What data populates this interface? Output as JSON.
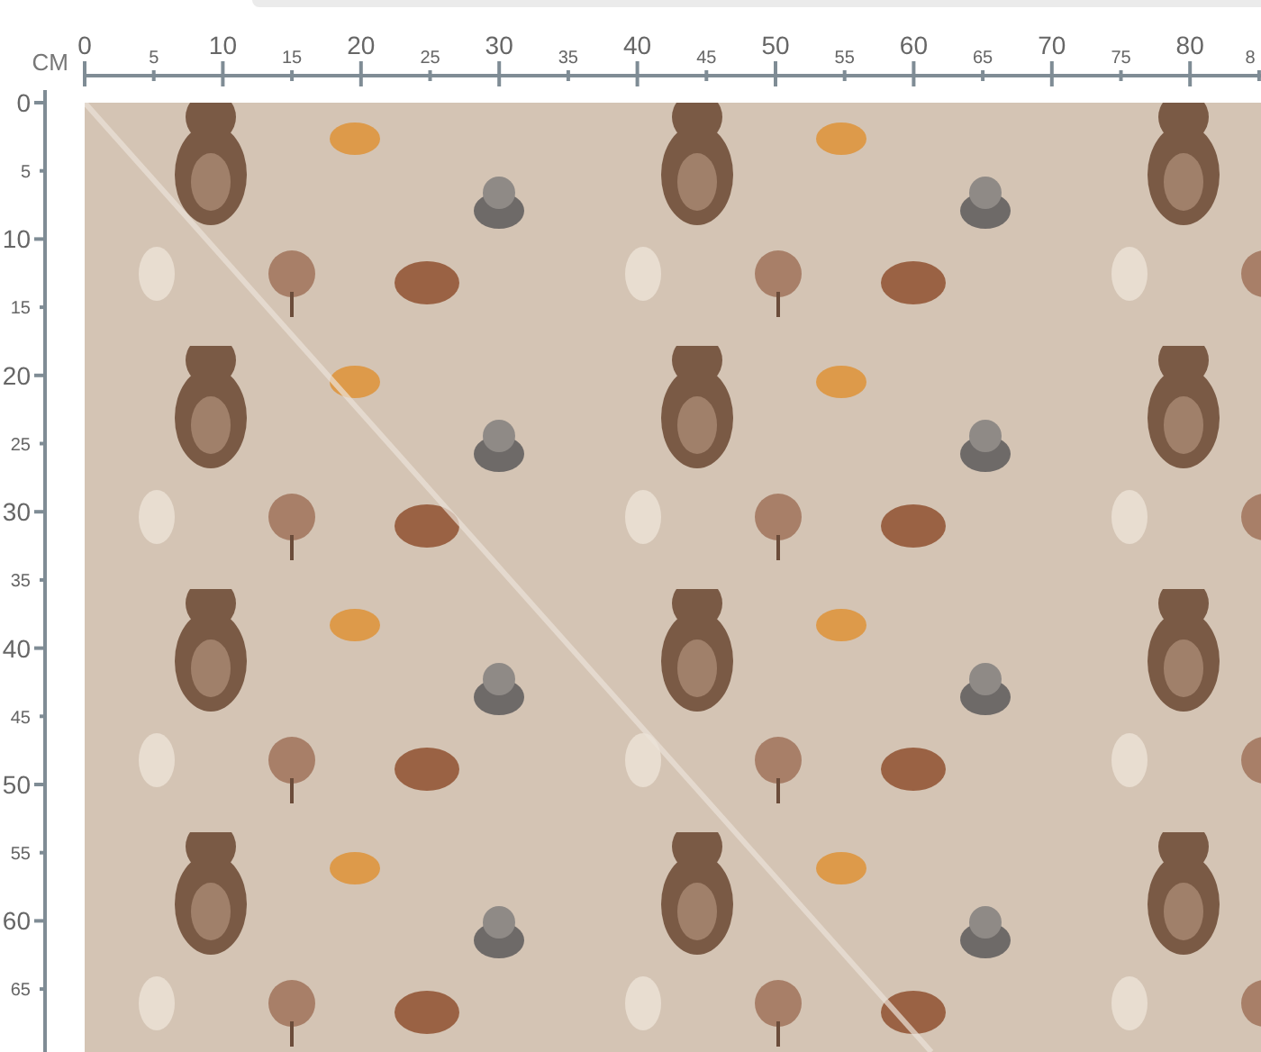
{
  "ruler_top": {
    "unit": "CM",
    "labels": [
      {
        "text": "0",
        "kind": "major"
      },
      {
        "text": "5",
        "kind": "minor"
      },
      {
        "text": "10",
        "kind": "major"
      },
      {
        "text": "15",
        "kind": "minor"
      },
      {
        "text": "20",
        "kind": "major"
      },
      {
        "text": "25",
        "kind": "minor"
      },
      {
        "text": "30",
        "kind": "major"
      },
      {
        "text": "35",
        "kind": "minor"
      },
      {
        "text": "40",
        "kind": "major"
      },
      {
        "text": "45",
        "kind": "minor"
      },
      {
        "text": "50",
        "kind": "major"
      },
      {
        "text": "55",
        "kind": "minor"
      },
      {
        "text": "60",
        "kind": "major"
      },
      {
        "text": "65",
        "kind": "minor"
      },
      {
        "text": "70",
        "kind": "major"
      },
      {
        "text": "75",
        "kind": "minor"
      },
      {
        "text": "80",
        "kind": "major"
      },
      {
        "text": "8",
        "kind": "minor"
      }
    ]
  },
  "ruler_left": {
    "labels": [
      {
        "text": "0",
        "kind": "major"
      },
      {
        "text": "5",
        "kind": "minor"
      },
      {
        "text": "10",
        "kind": "major"
      },
      {
        "text": "15",
        "kind": "minor"
      },
      {
        "text": "20",
        "kind": "major"
      },
      {
        "text": "25",
        "kind": "minor"
      },
      {
        "text": "30",
        "kind": "major"
      },
      {
        "text": "35",
        "kind": "minor"
      },
      {
        "text": "40",
        "kind": "major"
      },
      {
        "text": "45",
        "kind": "minor"
      },
      {
        "text": "50",
        "kind": "major"
      },
      {
        "text": "55",
        "kind": "minor"
      },
      {
        "text": "60",
        "kind": "major"
      },
      {
        "text": "65",
        "kind": "minor"
      }
    ]
  }
}
